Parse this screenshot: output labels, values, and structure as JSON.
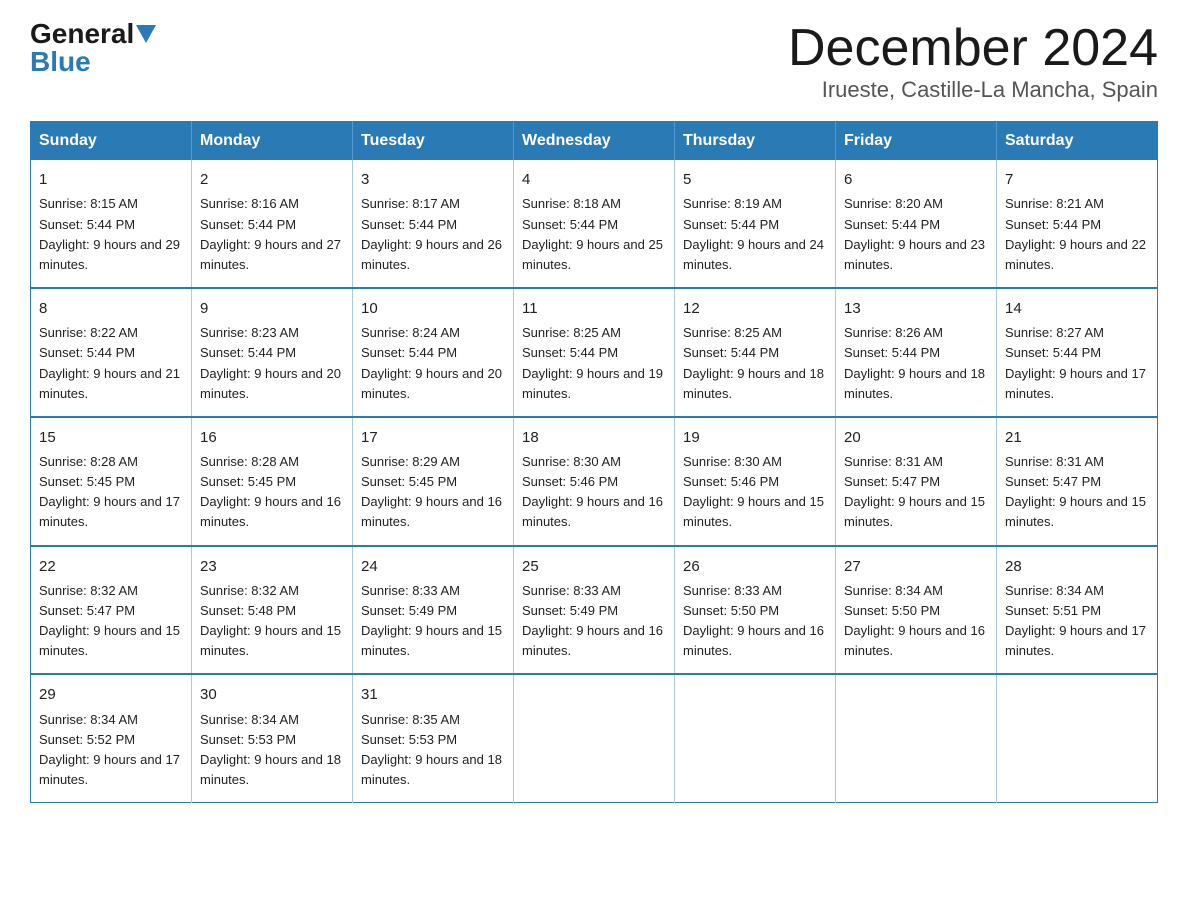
{
  "header": {
    "logo_general": "General",
    "logo_blue": "Blue",
    "month_title": "December 2024",
    "location": "Irueste, Castille-La Mancha, Spain"
  },
  "days_of_week": [
    "Sunday",
    "Monday",
    "Tuesday",
    "Wednesday",
    "Thursday",
    "Friday",
    "Saturday"
  ],
  "weeks": [
    [
      {
        "day": "1",
        "sunrise": "8:15 AM",
        "sunset": "5:44 PM",
        "daylight": "9 hours and 29 minutes."
      },
      {
        "day": "2",
        "sunrise": "8:16 AM",
        "sunset": "5:44 PM",
        "daylight": "9 hours and 27 minutes."
      },
      {
        "day": "3",
        "sunrise": "8:17 AM",
        "sunset": "5:44 PM",
        "daylight": "9 hours and 26 minutes."
      },
      {
        "day": "4",
        "sunrise": "8:18 AM",
        "sunset": "5:44 PM",
        "daylight": "9 hours and 25 minutes."
      },
      {
        "day": "5",
        "sunrise": "8:19 AM",
        "sunset": "5:44 PM",
        "daylight": "9 hours and 24 minutes."
      },
      {
        "day": "6",
        "sunrise": "8:20 AM",
        "sunset": "5:44 PM",
        "daylight": "9 hours and 23 minutes."
      },
      {
        "day": "7",
        "sunrise": "8:21 AM",
        "sunset": "5:44 PM",
        "daylight": "9 hours and 22 minutes."
      }
    ],
    [
      {
        "day": "8",
        "sunrise": "8:22 AM",
        "sunset": "5:44 PM",
        "daylight": "9 hours and 21 minutes."
      },
      {
        "day": "9",
        "sunrise": "8:23 AM",
        "sunset": "5:44 PM",
        "daylight": "9 hours and 20 minutes."
      },
      {
        "day": "10",
        "sunrise": "8:24 AM",
        "sunset": "5:44 PM",
        "daylight": "9 hours and 20 minutes."
      },
      {
        "day": "11",
        "sunrise": "8:25 AM",
        "sunset": "5:44 PM",
        "daylight": "9 hours and 19 minutes."
      },
      {
        "day": "12",
        "sunrise": "8:25 AM",
        "sunset": "5:44 PM",
        "daylight": "9 hours and 18 minutes."
      },
      {
        "day": "13",
        "sunrise": "8:26 AM",
        "sunset": "5:44 PM",
        "daylight": "9 hours and 18 minutes."
      },
      {
        "day": "14",
        "sunrise": "8:27 AM",
        "sunset": "5:44 PM",
        "daylight": "9 hours and 17 minutes."
      }
    ],
    [
      {
        "day": "15",
        "sunrise": "8:28 AM",
        "sunset": "5:45 PM",
        "daylight": "9 hours and 17 minutes."
      },
      {
        "day": "16",
        "sunrise": "8:28 AM",
        "sunset": "5:45 PM",
        "daylight": "9 hours and 16 minutes."
      },
      {
        "day": "17",
        "sunrise": "8:29 AM",
        "sunset": "5:45 PM",
        "daylight": "9 hours and 16 minutes."
      },
      {
        "day": "18",
        "sunrise": "8:30 AM",
        "sunset": "5:46 PM",
        "daylight": "9 hours and 16 minutes."
      },
      {
        "day": "19",
        "sunrise": "8:30 AM",
        "sunset": "5:46 PM",
        "daylight": "9 hours and 15 minutes."
      },
      {
        "day": "20",
        "sunrise": "8:31 AM",
        "sunset": "5:47 PM",
        "daylight": "9 hours and 15 minutes."
      },
      {
        "day": "21",
        "sunrise": "8:31 AM",
        "sunset": "5:47 PM",
        "daylight": "9 hours and 15 minutes."
      }
    ],
    [
      {
        "day": "22",
        "sunrise": "8:32 AM",
        "sunset": "5:47 PM",
        "daylight": "9 hours and 15 minutes."
      },
      {
        "day": "23",
        "sunrise": "8:32 AM",
        "sunset": "5:48 PM",
        "daylight": "9 hours and 15 minutes."
      },
      {
        "day": "24",
        "sunrise": "8:33 AM",
        "sunset": "5:49 PM",
        "daylight": "9 hours and 15 minutes."
      },
      {
        "day": "25",
        "sunrise": "8:33 AM",
        "sunset": "5:49 PM",
        "daylight": "9 hours and 16 minutes."
      },
      {
        "day": "26",
        "sunrise": "8:33 AM",
        "sunset": "5:50 PM",
        "daylight": "9 hours and 16 minutes."
      },
      {
        "day": "27",
        "sunrise": "8:34 AM",
        "sunset": "5:50 PM",
        "daylight": "9 hours and 16 minutes."
      },
      {
        "day": "28",
        "sunrise": "8:34 AM",
        "sunset": "5:51 PM",
        "daylight": "9 hours and 17 minutes."
      }
    ],
    [
      {
        "day": "29",
        "sunrise": "8:34 AM",
        "sunset": "5:52 PM",
        "daylight": "9 hours and 17 minutes."
      },
      {
        "day": "30",
        "sunrise": "8:34 AM",
        "sunset": "5:53 PM",
        "daylight": "9 hours and 18 minutes."
      },
      {
        "day": "31",
        "sunrise": "8:35 AM",
        "sunset": "5:53 PM",
        "daylight": "9 hours and 18 minutes."
      },
      null,
      null,
      null,
      null
    ]
  ]
}
